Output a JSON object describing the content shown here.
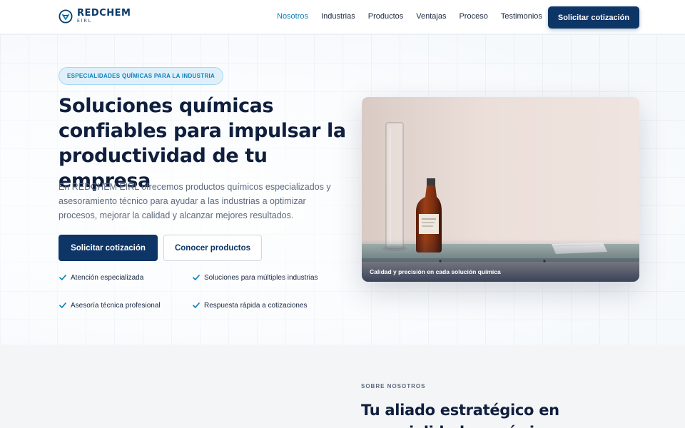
{
  "brand": {
    "name": "REDCHEM",
    "suffix": "EIRL"
  },
  "nav": {
    "items": [
      {
        "label": "Nosotros",
        "active": true
      },
      {
        "label": "Industrias",
        "active": false
      },
      {
        "label": "Productos",
        "active": false
      },
      {
        "label": "Ventajas",
        "active": false
      },
      {
        "label": "Proceso",
        "active": false
      },
      {
        "label": "Testimonios",
        "active": false
      }
    ],
    "cta_label": "Solicitar cotización"
  },
  "hero": {
    "badge": "ESPECIALIDADES QUÍMICAS PARA LA INDUSTRIA",
    "title": "Soluciones químicas confiables para impulsar la productividad de tu empresa",
    "description": "En REDCHEM EIRL ofrecemos productos químicos especializados y asesoramiento técnico para ayudar a las industrias a optimizar procesos, mejorar la calidad y alcanzar mejores resultados.",
    "primary_button": "Solicitar cotización",
    "secondary_button": "Conocer productos",
    "features": [
      "Atención especializada",
      "Soluciones para múltiples industrias",
      "Asesoría técnica profesional",
      "Respuesta rápida a cotizaciones"
    ],
    "image_caption": "Calidad y precisión en cada solución química"
  },
  "about": {
    "eyebrow": "SOBRE NOSOTROS",
    "title": "Tu aliado estratégico en especialidades químicas"
  },
  "colors": {
    "primary": "#0d3566",
    "accent": "#0d7fb8",
    "text": "#0f1f3d",
    "muted": "#5d6a7e"
  },
  "icons": [
    "logo-mark-icon",
    "check-icon"
  ]
}
